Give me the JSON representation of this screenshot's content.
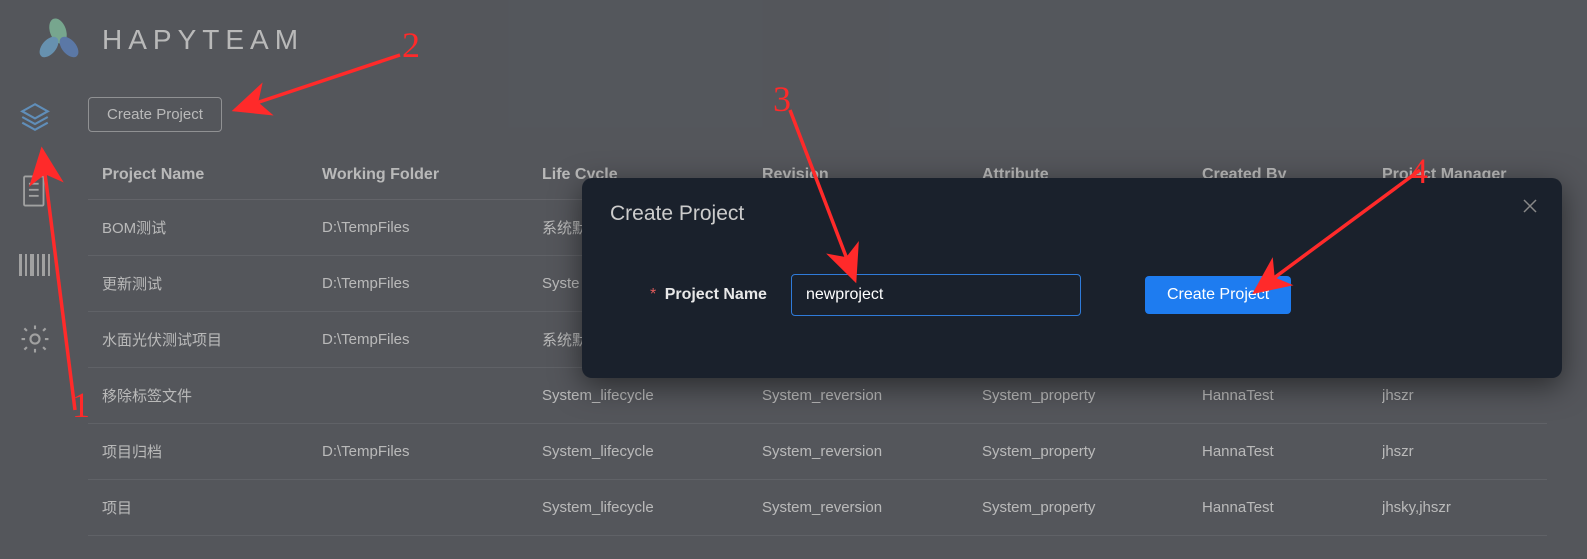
{
  "brand": "HAPYTEAM",
  "toolbar": {
    "create_label": "Create Project"
  },
  "table": {
    "headers": [
      "Project Name",
      "Working Folder",
      "Life Cycle",
      "Revision",
      "Attribute",
      "Created By",
      "Project Manager"
    ],
    "rows": [
      {
        "c": [
          "BOM测试",
          "D:\\TempFiles",
          "系统默",
          "",
          "",
          "",
          ""
        ]
      },
      {
        "c": [
          "更新测试",
          "D:\\TempFiles",
          "Syste",
          "",
          "",
          "",
          ""
        ]
      },
      {
        "c": [
          "水面光伏测试项目",
          "D:\\TempFiles",
          "系统默",
          "",
          "",
          "",
          ""
        ]
      },
      {
        "c": [
          "移除标签文件",
          "",
          "System_lifecycle",
          "System_reversion",
          "System_property",
          "HannaTest",
          "jhszr"
        ]
      },
      {
        "c": [
          "项目归档",
          "D:\\TempFiles",
          "System_lifecycle",
          "System_reversion",
          "System_property",
          "HannaTest",
          "jhszr"
        ]
      },
      {
        "c": [
          "项目",
          "",
          "System_lifecycle",
          "System_reversion",
          "System_property",
          "HannaTest",
          "jhsky,jhszr"
        ]
      }
    ]
  },
  "modal": {
    "title": "Create Project",
    "field_label": "Project Name",
    "input_value": "newproject",
    "submit_label": "Create Project"
  },
  "annotations": {
    "n1": "1",
    "n2": "2",
    "n3": "3",
    "n4": "4"
  }
}
